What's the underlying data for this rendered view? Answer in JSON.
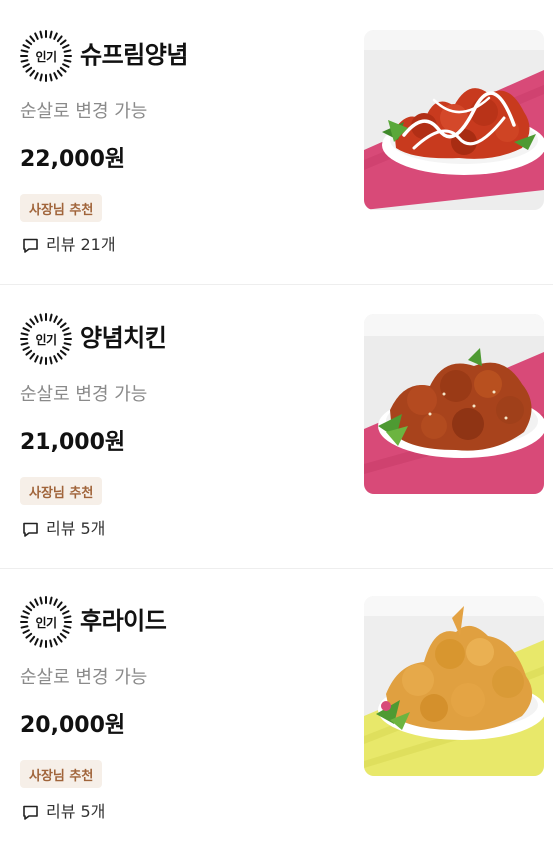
{
  "menu": {
    "items": [
      {
        "badge": "인기",
        "name": "슈프림양념",
        "option": "순살로 변경 가능",
        "price": "22,000원",
        "tag": "사장님 추천",
        "review_label": "리뷰",
        "review_count": "21개",
        "photo": "supreme-yangnyeom-chicken",
        "photo_colors": {
          "cloth": "#d84a78",
          "chicken": "#c83a1e",
          "sauce": "#ffffff"
        }
      },
      {
        "badge": "인기",
        "name": "양념치킨",
        "option": "순살로 변경 가능",
        "price": "21,000원",
        "tag": "사장님 추천",
        "review_label": "리뷰",
        "review_count": "5개",
        "photo": "yangnyeom-chicken",
        "photo_colors": {
          "cloth": "#d84a78",
          "chicken": "#a8431c"
        }
      },
      {
        "badge": "인기",
        "name": "후라이드",
        "option": "순살로 변경 가능",
        "price": "20,000원",
        "tag": "사장님 추천",
        "review_label": "리뷰",
        "review_count": "5개",
        "photo": "fried-chicken",
        "photo_colors": {
          "cloth": "#e8e86a",
          "chicken": "#e0a040"
        }
      }
    ]
  }
}
